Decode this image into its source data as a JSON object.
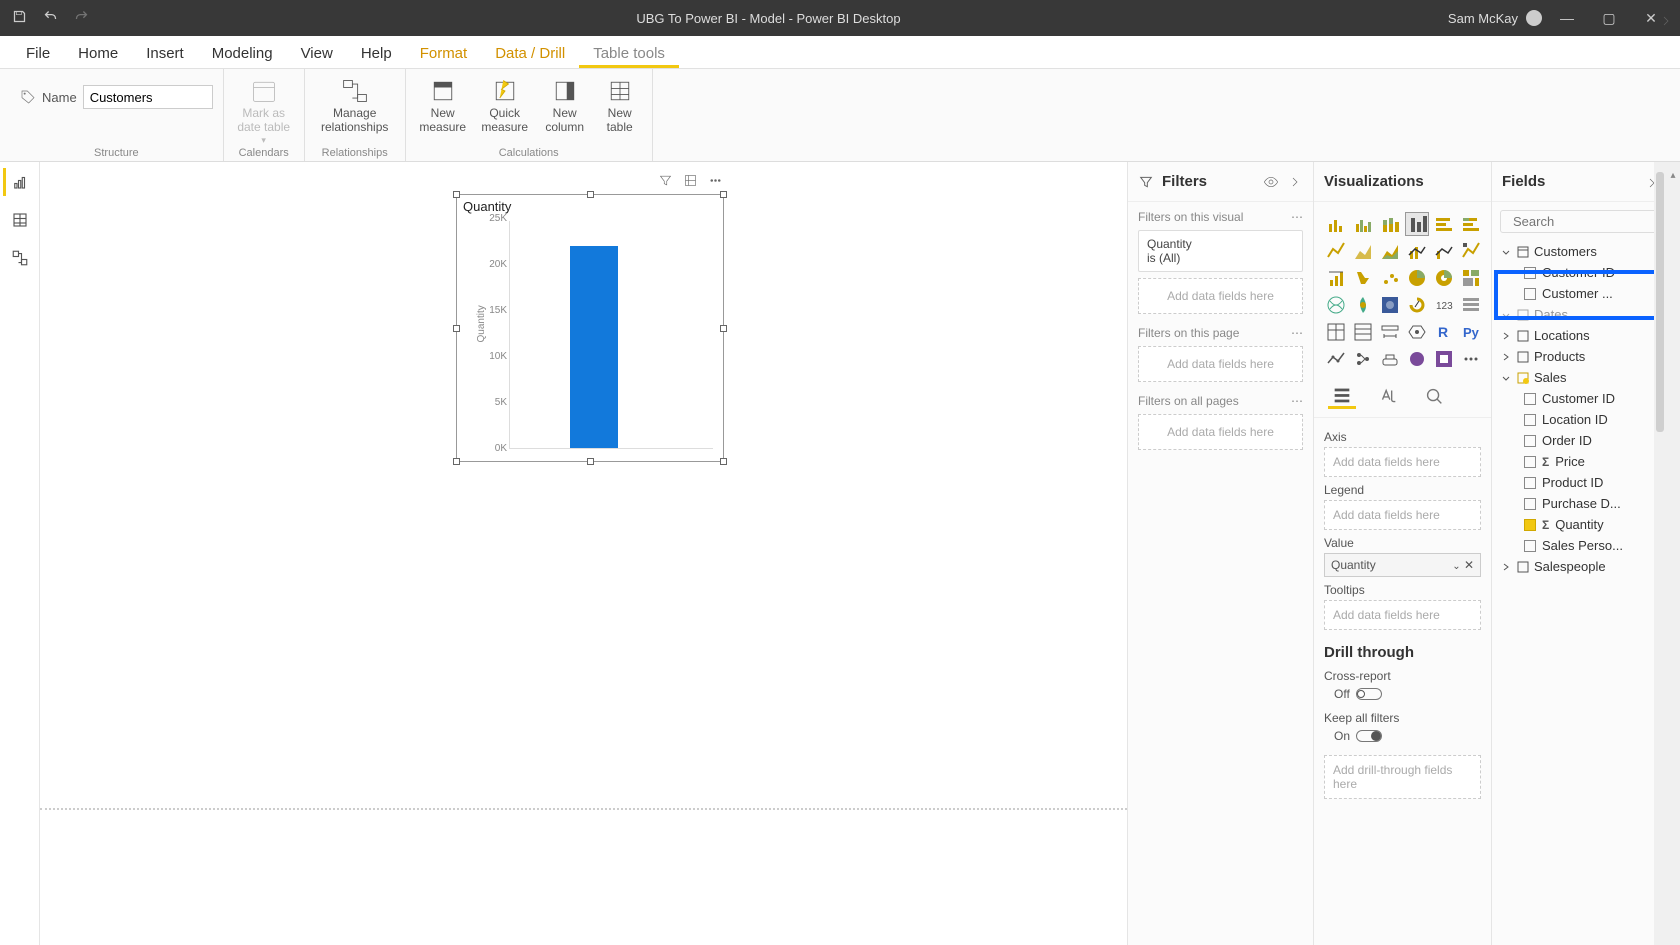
{
  "titlebar": {
    "title": "UBG To Power BI - Model - Power BI Desktop",
    "user": "Sam McKay"
  },
  "menu": {
    "file": "File",
    "home": "Home",
    "insert": "Insert",
    "modeling": "Modeling",
    "view": "View",
    "help": "Help",
    "format": "Format",
    "datadrill": "Data / Drill",
    "tabletools": "Table tools"
  },
  "ribbon": {
    "name_label": "Name",
    "name_value": "Customers",
    "mark_date": "Mark as date table",
    "manage_rel": "Manage relationships",
    "new_measure": "New measure",
    "quick_measure": "Quick measure",
    "new_column": "New column",
    "new_table": "New table",
    "grp_structure": "Structure",
    "grp_calendars": "Calendars",
    "grp_relationships": "Relationships",
    "grp_calculations": "Calculations"
  },
  "filters": {
    "header": "Filters",
    "visual_label": "Filters on this visual",
    "quantity": "Quantity",
    "is_all": "is (All)",
    "add": "Add data fields here",
    "page_label": "Filters on this page",
    "all_label": "Filters on all pages"
  },
  "viz": {
    "header": "Visualizations",
    "axis": "Axis",
    "legend": "Legend",
    "value": "Value",
    "quantity_chip": "Quantity",
    "tooltips": "Tooltips",
    "add": "Add data fields here",
    "drill": "Drill through",
    "cross": "Cross-report",
    "off": "Off",
    "keep": "Keep all filters",
    "on": "On",
    "drill_add": "Add drill-through fields here"
  },
  "fields": {
    "header": "Fields",
    "search": "Search",
    "tables": {
      "customers": "Customers",
      "cust_id": "Customer ID",
      "cust_name": "Customer ...",
      "dates": "Dates",
      "locations": "Locations",
      "products": "Products",
      "sales": "Sales",
      "s_cust": "Customer ID",
      "s_loc": "Location ID",
      "s_order": "Order ID",
      "s_price": "Price",
      "s_prod": "Product ID",
      "s_purch": "Purchase D...",
      "s_qty": "Quantity",
      "s_person": "Sales Perso...",
      "salespeople": "Salespeople"
    }
  },
  "chart_data": {
    "type": "bar",
    "title": "Quantity",
    "ylabel": "Quantity",
    "categories": [
      ""
    ],
    "values": [
      22000
    ],
    "yticks": [
      0,
      5000,
      10000,
      15000,
      20000,
      25000
    ],
    "ytick_labels": [
      "0K",
      "5K",
      "10K",
      "15K",
      "20K",
      "25K"
    ],
    "ylim": [
      0,
      25000
    ]
  }
}
